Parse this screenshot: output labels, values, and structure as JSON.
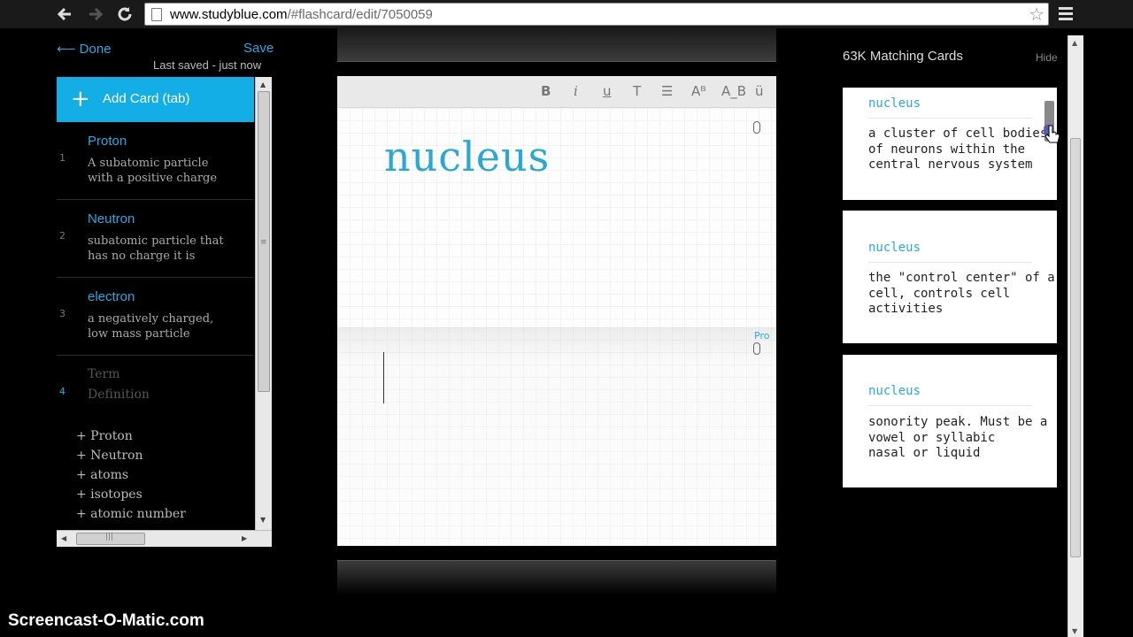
{
  "browser": {
    "url_host": "www.studyblue.com",
    "url_path": "/#flashcard/edit/7050059",
    "back_icon": "arrow-left-icon",
    "forward_icon": "arrow-right-icon",
    "reload_icon": "reload-icon",
    "star_icon": "star-icon",
    "menu_icon": "menu-icon"
  },
  "left_panel": {
    "done_label": "⟵ Done",
    "save_label": "Save",
    "last_saved": "Last saved - just now",
    "add_card_label": "Add Card (tab)",
    "cards": [
      {
        "num": "1",
        "term": "Proton",
        "definition": "A subatomic particle\nwith a positive charge"
      },
      {
        "num": "2",
        "term": "Neutron",
        "definition": "subatomic particle that\nhas no charge it is"
      },
      {
        "num": "3",
        "term": "electron",
        "definition": "a negatively charged,\nlow mass particle"
      },
      {
        "num": "4",
        "term": "Term",
        "definition": "Definition"
      }
    ],
    "suggestions": [
      "+ Proton",
      "+ Neutron",
      "+ atoms",
      "+ isotopes",
      "+ atomic number"
    ]
  },
  "editor": {
    "toolbar": [
      "B",
      "i",
      "u",
      "T",
      "☰",
      "Aᴮ",
      "A_B",
      "ü"
    ],
    "term": "nucleus",
    "pro_label": "Pro"
  },
  "right_panel": {
    "title": "63K Matching Cards",
    "hide_label": "Hide",
    "matches": [
      {
        "term": "nucleus",
        "definition": "a cluster of cell bodies\nof neurons within the\ncentral nervous system"
      },
      {
        "term": "nucleus",
        "definition": "the \"control center\" of a\ncell, controls cell\nactivities"
      },
      {
        "term": "nucleus",
        "definition": "sonority peak. Must be a\nvowel or syllabic\nnasal or liquid"
      }
    ]
  },
  "watermark": "Screencast-O-Matic.com",
  "colors": {
    "accent": "#29a8e0",
    "add_card_bg": "#14aee6"
  }
}
